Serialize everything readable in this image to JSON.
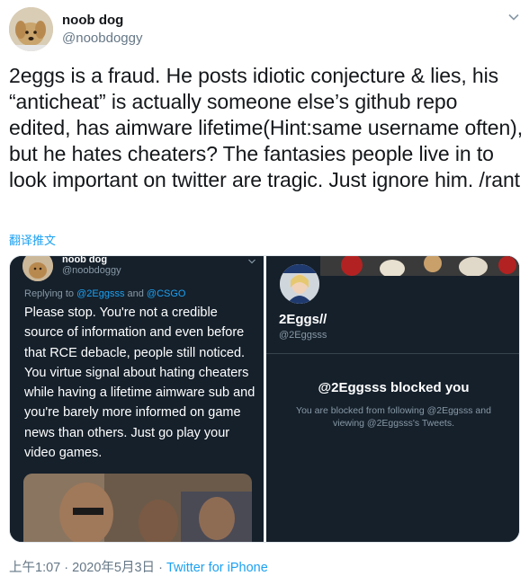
{
  "tweet": {
    "display_name": "noob dog",
    "handle": "@noobdoggy",
    "text": "2eggs is a fraud. He posts idiotic conjecture & lies, his “anticheat” is actually someone else’s github repo edited, has aimware lifetime(Hint:same username often), but he hates cheaters? The fantasies people live in to look important on twitter are tragic. Just ignore him. /rant",
    "translate_label": "翻译推文",
    "time": "上午1:07",
    "separator": "·",
    "date": "2020年5月3日",
    "source": "Twitter for iPhone"
  },
  "media": {
    "left": {
      "display_name": "noob dog",
      "handle": "@noobdoggy",
      "replying_prefix": "Replying to ",
      "reply_mention_1": "@2Eggsss",
      "reply_and": " and ",
      "reply_mention_2": "@CSGO",
      "body": "Please stop. You're not a credible source of information and even before that RCE debacle, people still noticed. You virtue signal about hating cheaters while having a lifetime aimware sub and you're barely more informed on game news than others. Just go play your video games."
    },
    "right": {
      "display_name": "2Eggs//",
      "handle": "@2Eggsss",
      "blocked_title": "@2Eggsss blocked you",
      "blocked_subtitle": "You are blocked from following @2Eggsss and viewing @2Eggsss's Tweets."
    }
  },
  "colors": {
    "link": "#1da1f2",
    "dark_bg": "#15202b",
    "secondary_text": "#657786"
  },
  "icons": [
    "avatar-dog",
    "chevron-down-icon"
  ]
}
